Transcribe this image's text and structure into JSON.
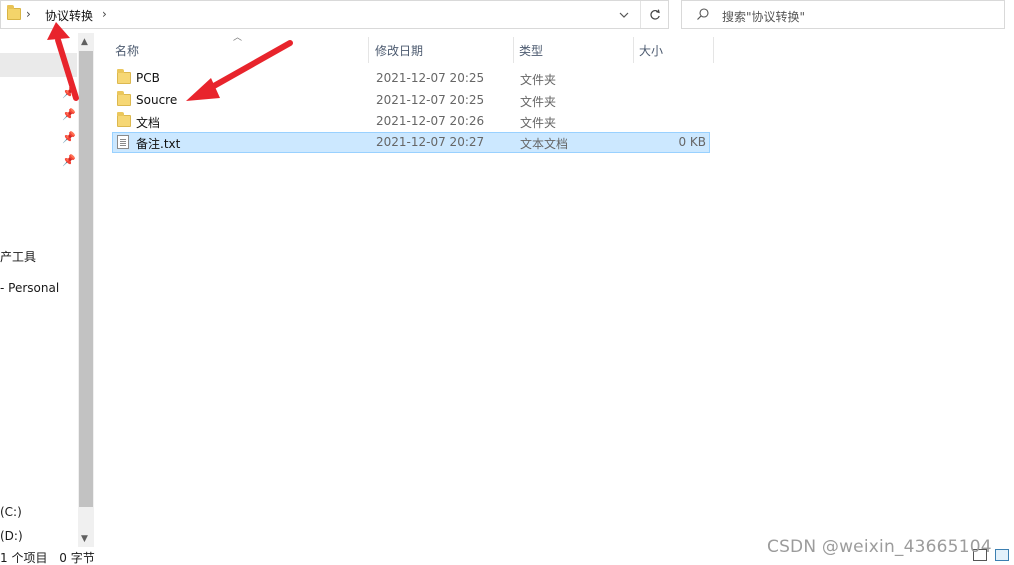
{
  "address_bar": {
    "separator": "›",
    "path": "协议转换",
    "trailing_separator": "›"
  },
  "search": {
    "placeholder": "搜索\"协议转换\""
  },
  "nav_pane": {
    "items": [
      {
        "label": "产工具"
      },
      {
        "label": "- Personal"
      },
      {
        "label": "(C:)"
      },
      {
        "label": "(D:)"
      }
    ]
  },
  "file_list": {
    "columns": [
      "名称",
      "修改日期",
      "类型",
      "大小"
    ],
    "rows": [
      {
        "name": "PCB",
        "date": "2021-12-07 20:25",
        "type": "文件夹",
        "size": "",
        "icon": "folder-icon"
      },
      {
        "name": "Soucre",
        "date": "2021-12-07 20:25",
        "type": "文件夹",
        "size": "",
        "icon": "folder-icon"
      },
      {
        "name": "文档",
        "date": "2021-12-07 20:26",
        "type": "文件夹",
        "size": "",
        "icon": "folder-icon"
      },
      {
        "name": "备注.txt",
        "date": "2021-12-07 20:27",
        "type": "文本文档",
        "size": "0 KB",
        "icon": "text-file-icon",
        "selected": true
      }
    ]
  },
  "status_bar": {
    "selected": "1 个项目",
    "size": "0 字节"
  },
  "watermark": "CSDN @weixin_43665104",
  "colors": {
    "selection": "#cce8ff",
    "selection_border": "#99d1ff",
    "annotation_arrow": "#e8242c"
  }
}
